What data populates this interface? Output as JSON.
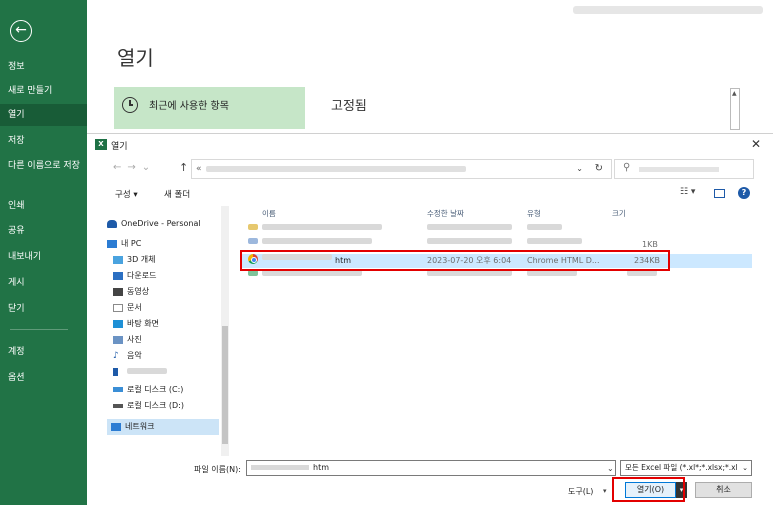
{
  "sidebar": {
    "items": [
      {
        "label": "정보"
      },
      {
        "label": "새로 만들기"
      },
      {
        "label": "열기"
      },
      {
        "label": "저장"
      },
      {
        "label": "다른 이름으로 저장"
      },
      {
        "label": "인쇄"
      },
      {
        "label": "공유"
      },
      {
        "label": "내보내기"
      },
      {
        "label": "게시"
      },
      {
        "label": "닫기"
      },
      {
        "label": "계정"
      },
      {
        "label": "옵션"
      }
    ]
  },
  "backstage": {
    "title": "열기",
    "recent_label": "최근에 사용한 항목",
    "pinned_title": "고정됨"
  },
  "dialog": {
    "title": "열기",
    "address_prefix": "«",
    "toolbar": {
      "organize": "구성 ▾",
      "new_folder": "새 폴더"
    },
    "nav_items": [
      {
        "label": "OneDrive - Personal",
        "icon": "onedrive-icon",
        "color": "#1e5aa8"
      },
      {
        "label": "내 PC",
        "icon": "pc-icon",
        "color": "#2b7cd3"
      },
      {
        "label": "3D 개체",
        "icon": "3d-objects-icon",
        "color": "#4aa3df"
      },
      {
        "label": "다운로드",
        "icon": "download-icon",
        "color": "#2b6fc2"
      },
      {
        "label": "동영상",
        "icon": "video-icon",
        "color": "#444444"
      },
      {
        "label": "문서",
        "icon": "document-icon",
        "color": "#8a8a8a"
      },
      {
        "label": "바탕 화면",
        "icon": "desktop-icon",
        "color": "#1e90d6"
      },
      {
        "label": "사진",
        "icon": "pictures-icon",
        "color": "#6b93c4"
      },
      {
        "label": "음악",
        "icon": "music-icon",
        "color": "#1e5aa8"
      },
      {
        "label": "",
        "icon": "phone-icon",
        "color": "#1e5aa8"
      },
      {
        "label": "로컬 디스크 (C:)",
        "icon": "drive-c-icon",
        "color": "#3a8ed6"
      },
      {
        "label": "로컬 디스크 (D:)",
        "icon": "drive-d-icon",
        "color": "#555555"
      },
      {
        "label": "네트워크",
        "icon": "network-icon",
        "color": "#2b7cd3"
      }
    ],
    "columns": {
      "name": "이름",
      "date": "수정한 날짜",
      "type": "유형",
      "size": "크기"
    },
    "files": [
      {
        "name": "",
        "date": "",
        "type": "",
        "size": ""
      },
      {
        "name": "",
        "date": "",
        "type": "",
        "size": "1KB"
      },
      {
        "name": "htm",
        "date": "2023-07-20 오후 6:04",
        "type": "Chrome HTML D...",
        "size": "234KB"
      },
      {
        "name": "",
        "date": "",
        "type": "",
        "size": ""
      }
    ],
    "filename_label": "파일 이름(N):",
    "filename_value": "htm",
    "filter_value": "모든 Excel 파일 (*.xl*;*.xlsx;*.xl",
    "tools_label": "도구(L)",
    "open_button": "열기(O)",
    "cancel_button": "취소"
  },
  "colors": {
    "excel_green": "#217346",
    "selected_row": "#cce8ff",
    "highlight_red": "#e30000"
  }
}
